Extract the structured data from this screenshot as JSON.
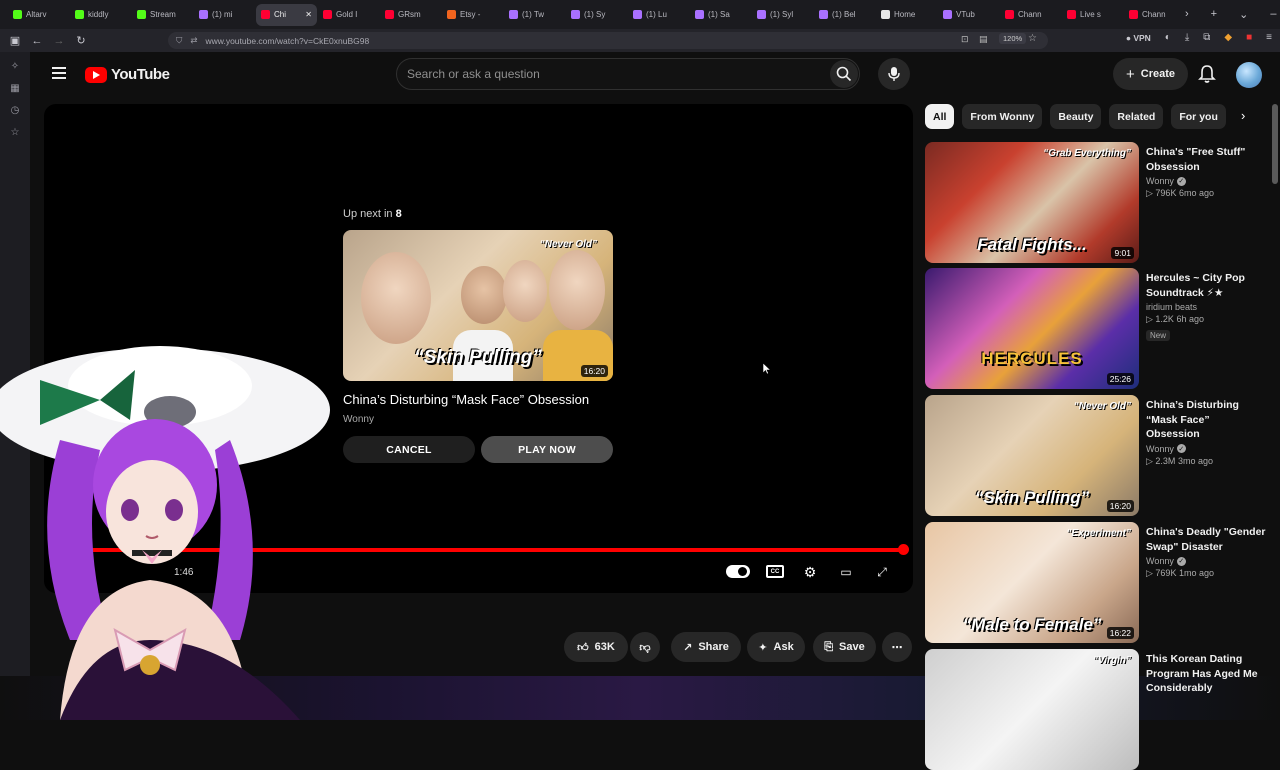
{
  "browser": {
    "tabs": [
      {
        "label": "Altarv",
        "color": "#53fc18"
      },
      {
        "label": "kiddly",
        "color": "#53fc18"
      },
      {
        "label": "Stream",
        "color": "#53fc18"
      },
      {
        "label": "(1) mi",
        "color": "#a970ff"
      },
      {
        "label": "Chi",
        "color": "#ff0033",
        "active": true
      },
      {
        "label": "Gold I",
        "color": "#ff0033"
      },
      {
        "label": "GRsm",
        "color": "#ff0033"
      },
      {
        "label": "Etsy -",
        "color": "#f1641e"
      },
      {
        "label": "(1) Tw",
        "color": "#a970ff"
      },
      {
        "label": "(1) Sy",
        "color": "#a970ff"
      },
      {
        "label": "(1) Lu",
        "color": "#a970ff"
      },
      {
        "label": "(1) Sa",
        "color": "#a970ff"
      },
      {
        "label": "(1) Syl",
        "color": "#a970ff"
      },
      {
        "label": "(1) Bel",
        "color": "#a970ff"
      },
      {
        "label": "Home",
        "color": "#e7e7e7"
      },
      {
        "label": "VTub",
        "color": "#a970ff"
      },
      {
        "label": "Chann",
        "color": "#ff0033"
      },
      {
        "label": "Live s",
        "color": "#ff0033"
      },
      {
        "label": "Chann",
        "color": "#ff0033"
      }
    ],
    "url": "www.youtube.com/watch?v=CkE0xnuBG98",
    "zoom": "120%",
    "vpn": "VPN"
  },
  "header": {
    "logo_text": "YouTube",
    "search_placeholder": "Search or ask a question",
    "create_label": "Create"
  },
  "player": {
    "upnext_prefix": "Up next in",
    "upnext_count": "8",
    "upnext_title": "China’s Disturbing “Mask Face” Obsession",
    "upnext_channel": "Wonny",
    "thumb_caption": "“Skin Pulling”",
    "thumb_tag": "“Never Old”",
    "thumb_duration": "16:20",
    "cancel_label": "CANCEL",
    "play_label": "PLAY NOW",
    "time_readout": "1:46",
    "progress_fraction": 1.0
  },
  "actions": {
    "like_count": "63K",
    "share_label": "Share",
    "ask_label": "Ask",
    "save_label": "Save"
  },
  "chips": [
    "All",
    "From Wonny",
    "Beauty",
    "Related",
    "For you"
  ],
  "recommendations": [
    {
      "title": "China's \"Free Stuff\" Obsession",
      "channel": "Wonny",
      "verified": true,
      "views": "796K",
      "age": "6mo ago",
      "duration": "9:01",
      "caption": "Fatal Fights...",
      "tag": "“Grab Everything”",
      "badge": ""
    },
    {
      "title": "Hercules ~ City Pop Soundtrack ⚡★",
      "channel": "iridium beats",
      "verified": false,
      "views": "1.2K",
      "age": "6h ago",
      "duration": "25:26",
      "caption": "HERCULES",
      "tag": "",
      "badge": "New"
    },
    {
      "title": "China’s Disturbing “Mask Face” Obsession",
      "channel": "Wonny",
      "verified": true,
      "views": "2.3M",
      "age": "3mo ago",
      "duration": "16:20",
      "caption": "“Skin Pulling”",
      "tag": "“Never Old”",
      "badge": ""
    },
    {
      "title": "China's Deadly \"Gender Swap\" Disaster",
      "channel": "Wonny",
      "verified": true,
      "views": "769K",
      "age": "1mo ago",
      "duration": "16:22",
      "caption": "“Male to Female”",
      "tag": "“Experiment”",
      "badge": ""
    },
    {
      "title": "This Korean Dating Program Has Aged Me Considerably",
      "channel": "",
      "verified": false,
      "views": "",
      "age": "",
      "duration": "",
      "caption": "",
      "tag": "“Virgin”",
      "badge": ""
    }
  ],
  "colors": {
    "accent": "#ff0000",
    "bg": "#0f0f0f",
    "chip": "#272727"
  }
}
